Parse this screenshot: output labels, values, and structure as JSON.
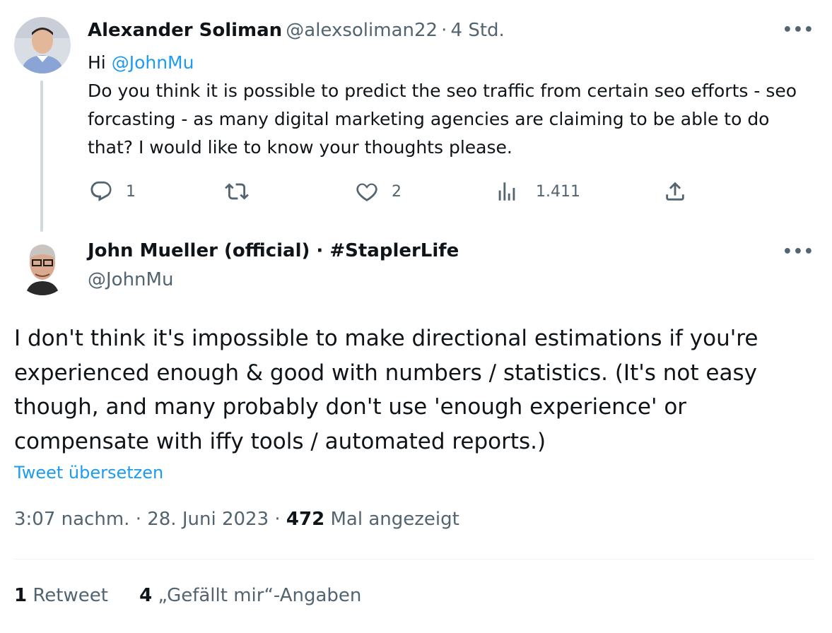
{
  "parent_tweet": {
    "author_name": "Alexander Soliman",
    "author_handle": "@alexsoliman22",
    "separator": "·",
    "time": "4 Std.",
    "greeting": "Hi",
    "mention": "@JohnMu",
    "text": "Do you think it is possible to predict the seo traffic from certain seo efforts - seo forcasting - as many digital marketing agencies are claiming to be able to do that? I would like to know your thoughts please.",
    "more": "•••",
    "actions": {
      "reply_count": "1",
      "retweet_count": "",
      "like_count": "2",
      "view_count": "1.411"
    }
  },
  "main_tweet": {
    "author_name": "John Mueller (official) · #StaplerLife",
    "author_handle": "@JohnMu",
    "more": "•••",
    "text": "I don't think it's impossible to make directional estimations if you're experienced enough & good with numbers / statistics. (It's not easy though, and many probably don't use 'enough experience' or compensate with iffy tools / automated reports.)",
    "translate_link": "Tweet übersetzen",
    "timestamp": "3:07 nachm. · 28. Juni 2023 ·",
    "views_count": "472",
    "views_label": "Mal angezeigt",
    "retweet_count": "1",
    "retweet_label": "Retweet",
    "like_count": "4",
    "like_label": "„Gefällt mir“-Angaben"
  },
  "colors": {
    "link": "#1d9bf0",
    "secondary_text": "#536471",
    "primary_text": "#0f1419",
    "thread_line": "#cfd9de"
  }
}
